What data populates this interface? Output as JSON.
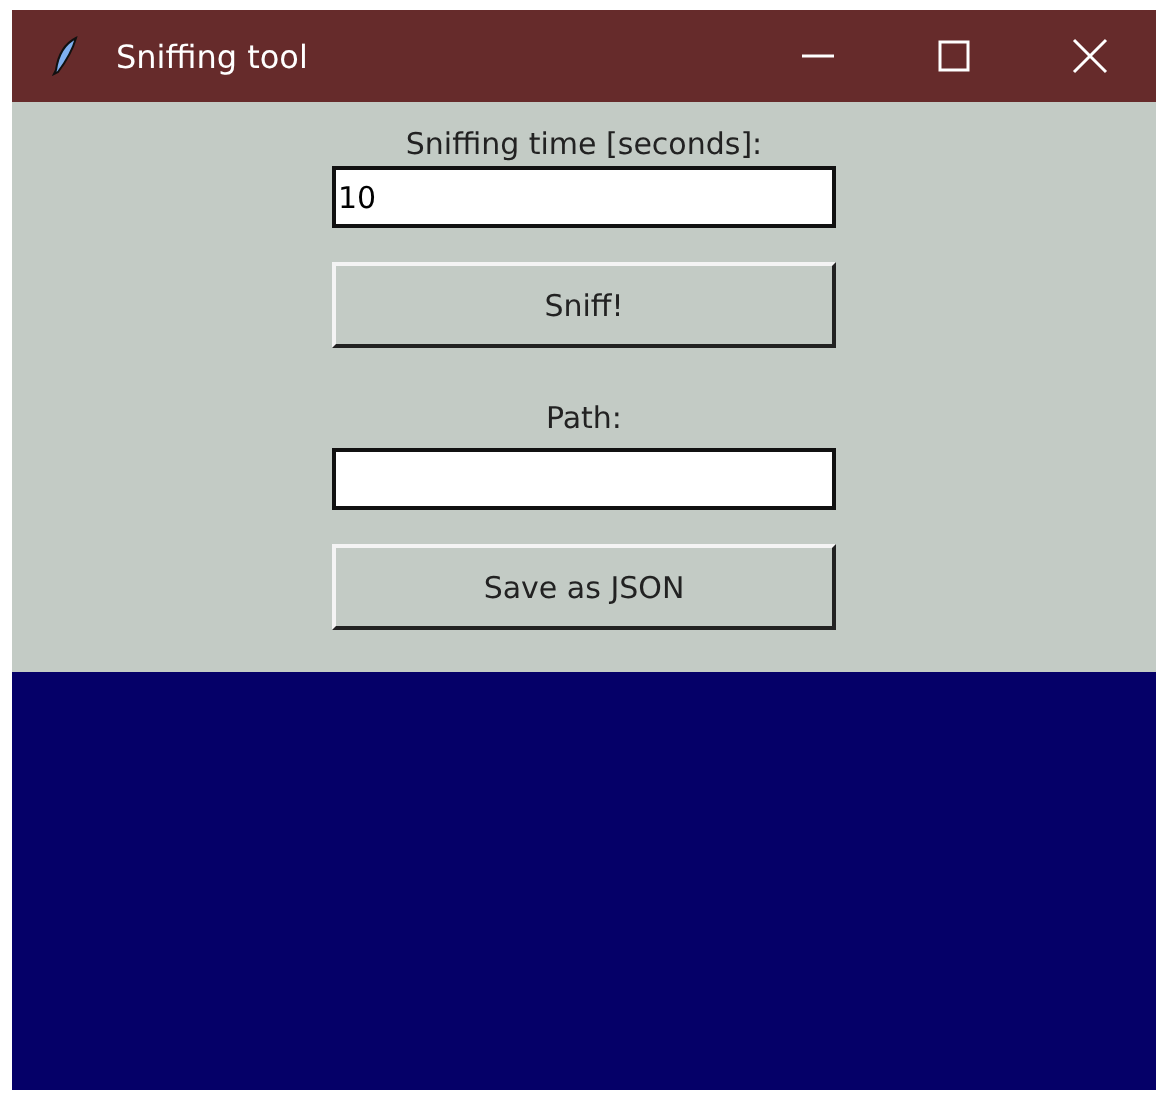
{
  "window": {
    "title": "Sniffing tool"
  },
  "time_label": "Sniffing time [seconds]:",
  "time_field": {
    "value": "10"
  },
  "sniff_button": "Sniff!",
  "path_label": "Path:",
  "save_button": "Save as JSON"
}
